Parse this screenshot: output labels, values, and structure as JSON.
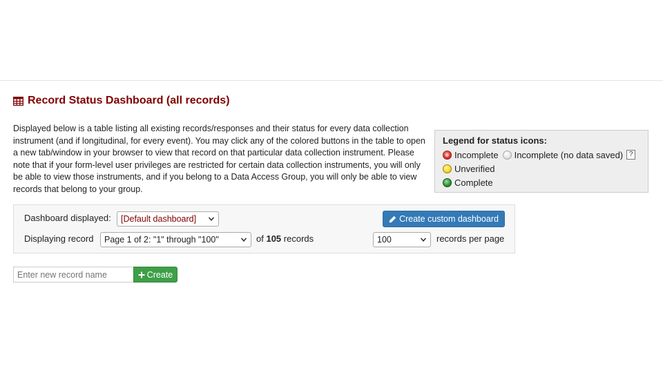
{
  "page": {
    "title": "Record Status Dashboard (all records)",
    "title_icon": "table-icon",
    "description": "Displayed below is a table listing all existing records/responses and their status for every data collection instrument (and if longitudinal, for every event). You may click any of the colored buttons in the table to open a new tab/window in your browser to view that record on that particular data collection instrument. Please note that if your form-level user privileges are restricted for certain data collection instruments, you will only be able to view those instruments, and if you belong to a Data Access Group, you will only be able to view records that belong to your group."
  },
  "legend": {
    "title": "Legend for status icons:",
    "incomplete": "Incomplete",
    "incomplete_no_data": "Incomplete (no data saved)",
    "help": "?",
    "unverified": "Unverified",
    "complete": "Complete",
    "colors": {
      "incomplete": "#e53935",
      "no_data": "#e6e6e6",
      "unverified": "#fdd835",
      "complete": "#2e9b36"
    }
  },
  "controls": {
    "dashboard_label": "Dashboard displayed:",
    "dashboard_value": "[Default dashboard]",
    "create_dashboard_label": "Create custom dashboard",
    "displaying_label": "Displaying record",
    "page_select_value": "Page 1 of 2: \"1\" through \"100\"",
    "of_text": "of",
    "record_count": "105",
    "records_text": "records",
    "per_page_value": "100",
    "per_page_label": "records per page"
  },
  "new_record": {
    "placeholder": "Enter new record name",
    "create_label": "Create"
  },
  "colors": {
    "title": "#800000",
    "primary_button": "#337ab7",
    "success_button": "#3e9f48"
  }
}
